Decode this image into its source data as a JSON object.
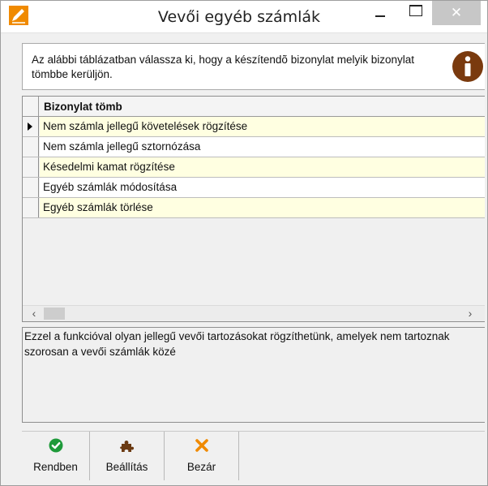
{
  "window": {
    "title": "Vevői egyéb számlák",
    "close_glyph": "✕"
  },
  "info": {
    "text": "Az alábbi táblázatban válassza ki, hogy a készítendõ bizonylat melyik bizonylat tömbbe kerüljön.",
    "icon": "info-icon"
  },
  "grid": {
    "header": "Bizonylat tömb",
    "rows": [
      "Nem számla jellegű követelések rögzítése",
      "Nem számla jellegű sztornózása",
      "Késedelmi kamat rögzítése",
      "Egyéb számlák módosítása",
      "Egyéb számlák törlése"
    ],
    "scroll_left": "‹",
    "scroll_right": "›"
  },
  "description": {
    "text": "Ezzel a funkcióval olyan jellegű vevői tartozásokat rögzíthetünk, amelyek nem tartoznak szorosan a vevői számlák közé"
  },
  "toolbar": {
    "ok_label": "Rendben",
    "settings_label": "Beállítás",
    "close_label": "Bezár"
  },
  "colors": {
    "row_highlight": "#ffffe1",
    "ok_green": "#1e9a3a",
    "settings_brown": "#6b3a12",
    "close_orange": "#f08a00",
    "info_brown": "#7a3a0e"
  }
}
